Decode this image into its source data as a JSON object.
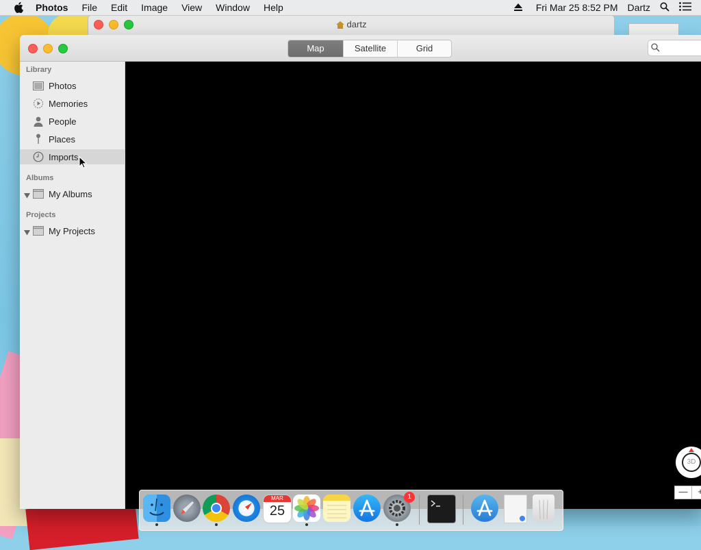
{
  "menubar": {
    "app_name": "Photos",
    "menus": [
      "File",
      "Edit",
      "Image",
      "View",
      "Window",
      "Help"
    ],
    "clock": "Fri Mar 25  8:52 PM",
    "user": "Dartz"
  },
  "background_window": {
    "title": "dartz"
  },
  "toolbar": {
    "view_modes": [
      "Map",
      "Satellite",
      "Grid"
    ],
    "active_view": "Map"
  },
  "sidebar": {
    "library_header": "Library",
    "library_items": [
      {
        "label": "Photos",
        "icon": "photos-icon"
      },
      {
        "label": "Memories",
        "icon": "memories-icon"
      },
      {
        "label": "People",
        "icon": "people-icon"
      },
      {
        "label": "Places",
        "icon": "places-icon"
      },
      {
        "label": "Imports",
        "icon": "imports-icon",
        "selected": true
      }
    ],
    "albums_header": "Albums",
    "albums_item": "My Albums",
    "projects_header": "Projects",
    "projects_item": "My Projects"
  },
  "map_controls": {
    "compass_label": "3D",
    "zoom_out": "—",
    "zoom_in": "+"
  },
  "dock": {
    "items": [
      "Finder",
      "Launchpad",
      "Google Chrome",
      "Safari",
      "Calendar",
      "Photos",
      "Notes",
      "App Store",
      "System Preferences",
      "Terminal",
      "Applications",
      "Document",
      "Trash"
    ],
    "calendar_month": "MAR",
    "calendar_day": "25",
    "system_prefs_badge": "1"
  },
  "colors": {
    "accent_segment": "#6d6d6d",
    "sidebar_bg": "#ececec",
    "map_bg": "#000000"
  }
}
